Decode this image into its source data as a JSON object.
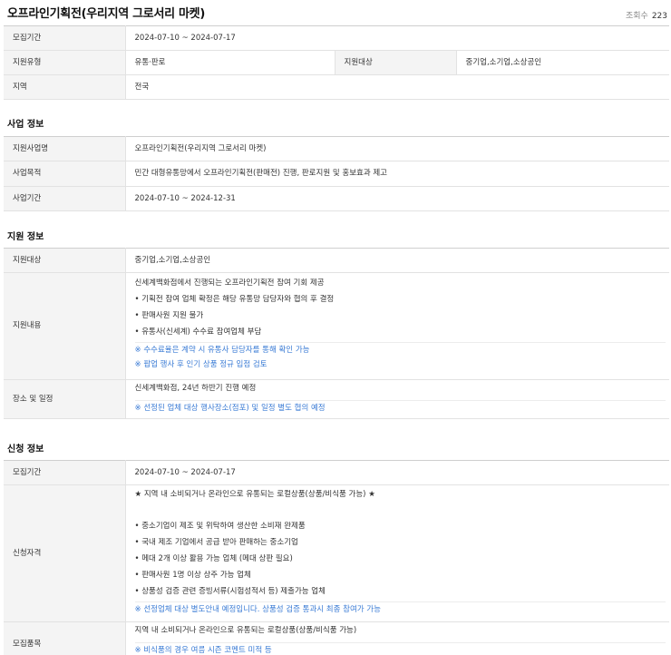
{
  "header": {
    "title": "오프라인기획전(우리지역 그로서리 마켓)",
    "views_label": "조회수",
    "views_count": "223"
  },
  "summary": {
    "recruit_label": "모집기간",
    "recruit_value": "2024-07-10 ~ 2024-07-17",
    "type_label": "지원유형",
    "type_value": "유통·판로",
    "target_label": "지원대상",
    "target_value": "중기업,소기업,소상공인",
    "region_label": "지역",
    "region_value": "전국"
  },
  "business": {
    "section_title": "사업 정보",
    "name_label": "지원사업명",
    "name_value": "오프라인기획전(우리지역 그로서리 마켓)",
    "purpose_label": "사업목적",
    "purpose_value": "민간 대형유통망에서 오프라인기획전(판매전) 진행, 판로지원 및 홍보효과 제고",
    "period_label": "사업기간",
    "period_value": "2024-07-10 ~ 2024-12-31"
  },
  "support": {
    "section_title": "지원 정보",
    "target_label": "지원대상",
    "target_value": "중기업,소기업,소상공인",
    "content_label": "지원내용",
    "content_lines": [
      "신세계백화점에서 진행되는 오프라인기획전 참여 기회 제공",
      "기획전 참여 업체 확정은 해당 유통망 담당자와 협의 후 결정",
      "판매사원 지원 불가",
      "유통사(신세계) 수수료 참여업체 부담"
    ],
    "content_notes": [
      "※ 수수료율은 계약 시 유통사 담당자를 통해 확인 가능",
      "※ 팝업 행사 후 인기 상품 정규 입점 검토"
    ],
    "place_label": "장소 및 일정",
    "place_value": "신세계백화점, 24년 하반기 진행 예정",
    "place_note": "※ 선정된 업체 대상 행사장소(점포) 및 일정 별도 협의 예정"
  },
  "apply": {
    "section_title": "신청 정보",
    "recruit_label": "모집기간",
    "recruit_value": "2024-07-10 ~ 2024-07-17",
    "qual_label": "신청자격",
    "qual_headline": "★ 지역 내 소비되거나 온라인으로 유통되는 로컬상품(상품/비식품 가능) ★",
    "qual_lines": [
      "중소기업이 제조 및 위탁하여 생산한 소비재 완제품",
      "국내 제조 기업에서 공급 받아 판매하는 중소기업",
      "메대 2개 이상 활용 가능 업체 (메대 상판 필요)",
      "판매사원 1명 이상 상주 가능 업체",
      "상품성 검증 관련 증빙서류(시험성적서 등) 제출가능 업체"
    ],
    "qual_note": "※ 선정업체 대상 별도안내 예정입니다. 상품성 검증 통과시 최종 참여가 가능",
    "items_label": "모집품목",
    "items_value": "지역 내 소비되거나 온라인으로 유통되는 로컬상품(상품/비식품 가능)",
    "items_note": "※ 비식품의 경우 여름 시즌 코멘트 미적 등"
  }
}
